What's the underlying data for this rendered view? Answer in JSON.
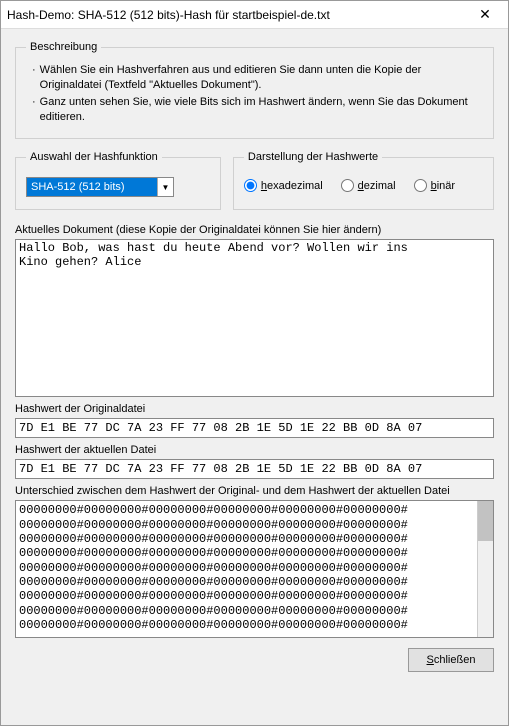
{
  "title": "Hash-Demo: SHA-512 (512 bits)-Hash für startbeispiel-de.txt",
  "closeIcon": "✕",
  "description": {
    "legend": "Beschreibung",
    "items": [
      "Wählen Sie ein Hashverfahren aus und editieren Sie dann unten die Kopie der Originaldatei (Textfeld \"Aktuelles Dokument\").",
      "Ganz unten sehen Sie, wie viele Bits sich im Hashwert ändern, wenn Sie das Dokument editieren."
    ]
  },
  "hashSelect": {
    "legend": "Auswahl der Hashfunktion",
    "selected": "SHA-512 (512 bits)",
    "arrow": "▼"
  },
  "representation": {
    "legend": "Darstellung der Hashwerte",
    "options": {
      "hex": {
        "accel": "h",
        "rest": "exadezimal"
      },
      "dec": {
        "accel": "d",
        "rest": "ezimal"
      },
      "bin": {
        "accel": "b",
        "rest": "inär"
      }
    },
    "selected": "hex"
  },
  "docLabel": "Aktuelles Dokument (diese Kopie der Originaldatei können Sie hier ändern)",
  "docText": "Hallo Bob, was hast du heute Abend vor? Wollen wir ins\nKino gehen? Alice",
  "origLabel": "Hashwert der Originaldatei",
  "origHash": "7D E1 BE 77 DC 7A 23 FF 77 08 2B 1E 5D 1E 22 BB 0D 8A 07",
  "curLabel": "Hashwert der aktuellen Datei",
  "curHash": "7D E1 BE 77 DC 7A 23 FF 77 08 2B 1E 5D 1E 22 BB 0D 8A 07",
  "diffLabel": "Unterschied zwischen dem Hashwert der Original- und dem Hashwert der aktuellen Datei",
  "diffText": "00000000#00000000#00000000#00000000#00000000#00000000#\n00000000#00000000#00000000#00000000#00000000#00000000#\n00000000#00000000#00000000#00000000#00000000#00000000#\n00000000#00000000#00000000#00000000#00000000#00000000#\n00000000#00000000#00000000#00000000#00000000#00000000#\n00000000#00000000#00000000#00000000#00000000#00000000#\n00000000#00000000#00000000#00000000#00000000#00000000#\n00000000#00000000#00000000#00000000#00000000#00000000#\n00000000#00000000#00000000#00000000#00000000#00000000#",
  "closeBtn": {
    "accel": "S",
    "rest": "chließen"
  }
}
